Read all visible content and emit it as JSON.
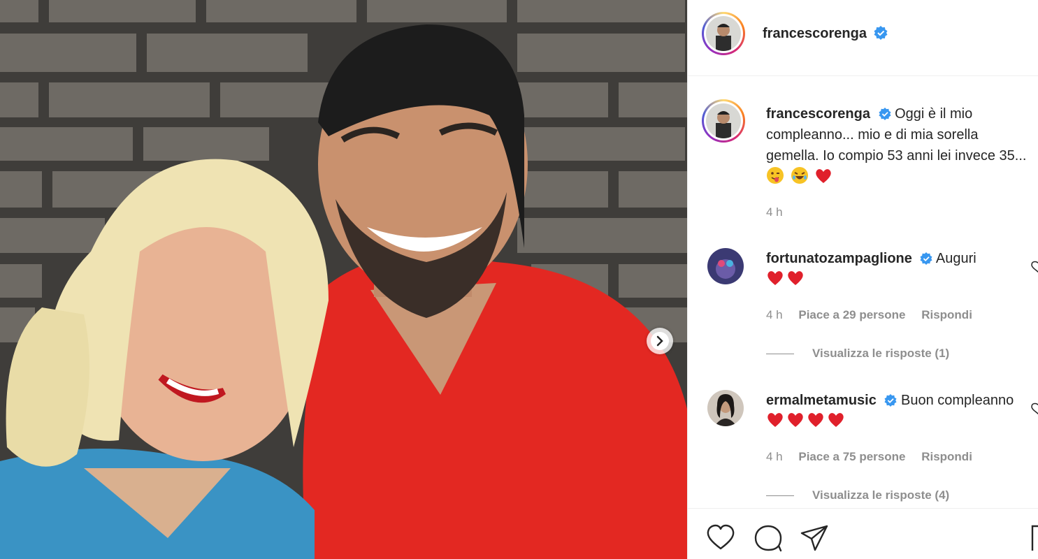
{
  "post": {
    "author": "francescorenga",
    "caption": "Oggi è il mio compleanno... mio e di mia sorella gemella. Io compio 53 anni lei invece 35...",
    "time": "4 h"
  },
  "comments": [
    {
      "user": "fortunatozampaglione",
      "text": "Auguri",
      "time": "4 h",
      "likes": "Piace a 29 persone",
      "reply": "Rispondi",
      "view_replies": "Visualizza le risposte (1)"
    },
    {
      "user": "ermalmetamusic",
      "text": "Buon compleanno",
      "time": "4 h",
      "likes": "Piace a 75 persone",
      "reply": "Rispondi",
      "view_replies": "Visualizza le risposte (4)"
    }
  ],
  "colors": {
    "verified": "#3897f0",
    "heart": "#ed4956",
    "text": "#262626",
    "secondary": "#8e8e8e"
  },
  "icons": [
    "heart-icon",
    "comment-icon",
    "share-icon",
    "bookmark-icon",
    "chevron-right-icon",
    "verified-icon"
  ]
}
